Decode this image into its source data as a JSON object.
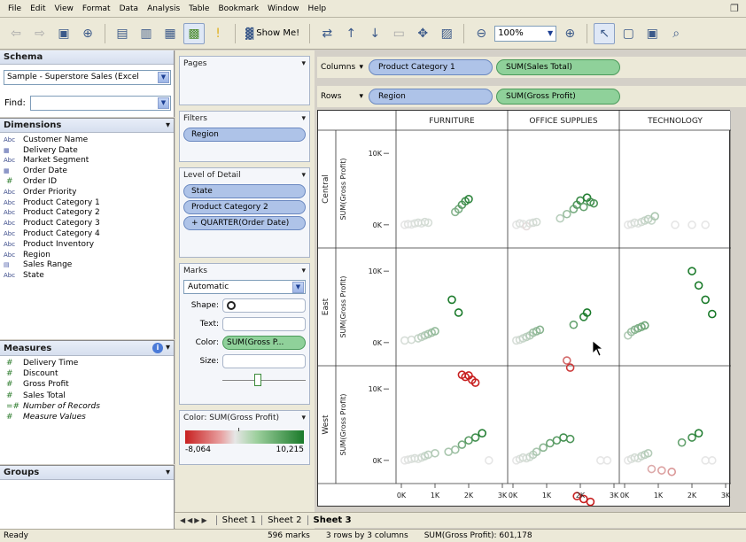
{
  "menu": [
    "File",
    "Edit",
    "View",
    "Format",
    "Data",
    "Analysis",
    "Table",
    "Bookmark",
    "Window",
    "Help"
  ],
  "toolbar": {
    "show_me": "Show Me!",
    "zoom": "100%"
  },
  "schema": {
    "title": "Schema",
    "datasource": "Sample - Superstore Sales (Excel",
    "find_label": "Find:"
  },
  "dimensions": {
    "title": "Dimensions",
    "items": [
      {
        "type": "Abc",
        "label": "Customer Name"
      },
      {
        "type": "cal",
        "label": "Delivery Date"
      },
      {
        "type": "Abc",
        "label": "Market Segment"
      },
      {
        "type": "cal",
        "label": "Order Date"
      },
      {
        "type": "#",
        "label": "Order ID"
      },
      {
        "type": "Abc",
        "label": "Order Priority"
      },
      {
        "type": "Abc",
        "label": "Product Category 1"
      },
      {
        "type": "Abc",
        "label": "Product Category 2"
      },
      {
        "type": "Abc",
        "label": "Product Category 3"
      },
      {
        "type": "Abc",
        "label": "Product Category 4"
      },
      {
        "type": "Abc",
        "label": "Product Inventory"
      },
      {
        "type": "Abc",
        "label": "Region"
      },
      {
        "type": "grp",
        "label": "Sales Range"
      },
      {
        "type": "Abc",
        "label": "State"
      }
    ]
  },
  "measures": {
    "title": "Measures",
    "items": [
      {
        "type": "#",
        "label": "Delivery Time",
        "italic": false
      },
      {
        "type": "#",
        "label": "Discount",
        "italic": false
      },
      {
        "type": "#",
        "label": "Gross Profit",
        "italic": false
      },
      {
        "type": "#",
        "label": "Sales Total",
        "italic": false
      },
      {
        "type": "=#",
        "label": "Number of Records",
        "italic": true
      },
      {
        "type": "#",
        "label": "Measure Values",
        "italic": true
      }
    ]
  },
  "groups": {
    "title": "Groups"
  },
  "pages": {
    "title": "Pages"
  },
  "filters": {
    "title": "Filters",
    "pills": [
      "Region"
    ]
  },
  "detail": {
    "title": "Level of Detail",
    "pills": [
      "State",
      "Product Category 2",
      "+ QUARTER(Order Date)"
    ]
  },
  "marks": {
    "title": "Marks",
    "type": "Automatic",
    "shape_label": "Shape:",
    "text_label": "Text:",
    "color_label": "Color:",
    "color_value": "SUM(Gross P...",
    "size_label": "Size:"
  },
  "legend": {
    "title": "Color: SUM(Gross Profit)",
    "min": "-8,064",
    "max": "10,215"
  },
  "shelves": {
    "columns_label": "Columns",
    "columns": [
      "Product Category 1",
      "SUM(Sales Total)"
    ],
    "rows_label": "Rows",
    "rows": [
      "Region",
      "SUM(Gross Profit)"
    ]
  },
  "chart_data": {
    "type": "scatter",
    "column_headers": [
      "FURNITURE",
      "OFFICE SUPPLIES",
      "TECHNOLOGY"
    ],
    "row_headers": [
      "Central",
      "East",
      "West"
    ],
    "ylabel": "SUM(Gross Profit)",
    "xlabel": "SUM(Sales Total)",
    "y_ticks": [
      "10K",
      "0K"
    ],
    "x_ticks": [
      "0K",
      "1K",
      "2K",
      "3K"
    ],
    "xlim": [
      0,
      3000
    ],
    "ylim": [
      -2000,
      12000
    ],
    "color_scale": [
      "#c82020",
      "#e6e6e6",
      "#1a7a2a"
    ],
    "panels": [
      [
        {
          "x": [
            100,
            200,
            300,
            400,
            500,
            600,
            700,
            800,
            1600,
            1700,
            1800,
            1900,
            2000
          ],
          "y": [
            0,
            100,
            50,
            200,
            300,
            200,
            400,
            300,
            1800,
            2200,
            2800,
            3300,
            3600
          ]
        },
        {
          "x": [
            100,
            200,
            300,
            400,
            500,
            600,
            700,
            1400,
            1600,
            1800,
            1900,
            2000,
            2100,
            2200,
            2300,
            2400
          ],
          "y": [
            0,
            200,
            100,
            -200,
            200,
            300,
            400,
            900,
            1500,
            2200,
            2800,
            3400,
            2500,
            3800,
            3200,
            3000
          ]
        },
        {
          "x": [
            100,
            200,
            300,
            400,
            500,
            600,
            700,
            800,
            900,
            1500,
            2000,
            2400
          ],
          "y": [
            0,
            100,
            300,
            200,
            400,
            600,
            800,
            600,
            1200,
            0,
            0,
            0
          ]
        }
      ],
      [
        {
          "x": [
            100,
            300,
            500,
            600,
            700,
            800,
            900,
            1000,
            1500,
            1700,
            1800,
            1900,
            2000,
            2100,
            2200
          ],
          "y": [
            300,
            400,
            600,
            800,
            1000,
            1200,
            1400,
            1600,
            6000,
            4200,
            -4500,
            -4800,
            -4600,
            -5200,
            -5600
          ]
        },
        {
          "x": [
            100,
            200,
            300,
            400,
            500,
            600,
            700,
            800,
            1600,
            1700,
            1800,
            2100,
            2200
          ],
          "y": [
            300,
            400,
            600,
            800,
            1000,
            1400,
            1600,
            1800,
            -2500,
            -3500,
            2500,
            3600,
            4200
          ]
        },
        {
          "x": [
            100,
            200,
            300,
            400,
            500,
            600,
            2000,
            2200,
            2400,
            2600
          ],
          "y": [
            1000,
            1500,
            1800,
            2000,
            2200,
            2400,
            10000,
            8000,
            6000,
            4000
          ]
        }
      ],
      [
        {
          "x": [
            100,
            200,
            300,
            400,
            500,
            600,
            700,
            800,
            1000,
            1400,
            1600,
            1800,
            2000,
            2200,
            2400,
            2600
          ],
          "y": [
            0,
            100,
            200,
            300,
            200,
            400,
            600,
            800,
            1000,
            1200,
            1500,
            2200,
            2800,
            3200,
            3800,
            0
          ]
        },
        {
          "x": [
            100,
            200,
            300,
            400,
            500,
            600,
            700,
            900,
            1100,
            1300,
            1500,
            1700,
            1900,
            2100,
            2300,
            2600,
            2800
          ],
          "y": [
            0,
            200,
            400,
            300,
            500,
            800,
            1200,
            1800,
            2400,
            2800,
            3200,
            3000,
            -5000,
            -5400,
            -5800,
            0,
            0
          ]
        },
        {
          "x": [
            100,
            200,
            300,
            400,
            500,
            600,
            700,
            800,
            1100,
            1400,
            1700,
            2000,
            2200,
            2400,
            2600
          ],
          "y": [
            0,
            200,
            400,
            300,
            600,
            800,
            1000,
            -1200,
            -1400,
            -1600,
            2500,
            3200,
            3800,
            0,
            0
          ]
        }
      ]
    ]
  },
  "tabs": [
    "Sheet 1",
    "Sheet 2",
    "Sheet 3"
  ],
  "status": {
    "ready": "Ready",
    "marks": "596 marks",
    "dims": "3 rows by 3 columns",
    "sum": "SUM(Gross Profit): 601,178"
  }
}
